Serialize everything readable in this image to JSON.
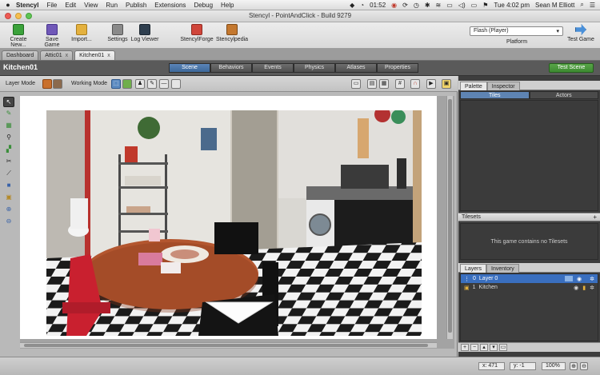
{
  "menubar": {
    "apple": "",
    "app": "Stencyl",
    "items": [
      "File",
      "Edit",
      "View",
      "Run",
      "Publish",
      "Extensions",
      "Debug",
      "Help"
    ],
    "clock_count": "01:52",
    "time": "Tue 4:02 pm",
    "user": "Sean M Elliott"
  },
  "window": {
    "title": "Stencyl - PointAndClick - Build 9279"
  },
  "toolbar": {
    "create_new": "Create New...",
    "save_game": "Save Game",
    "import": "Import...",
    "settings": "Settings",
    "log_viewer": "Log Viewer",
    "stencylforge": "StencylForge",
    "stencylpedia": "Stencylpedia",
    "target": "Flash (Player)",
    "platform_label": "Platform",
    "test_game": "Test Game"
  },
  "doc_tabs": [
    {
      "label": "Dashboard"
    },
    {
      "label": "Attic01",
      "close": "x"
    },
    {
      "label": "Kitchen01",
      "close": "x"
    }
  ],
  "scene": {
    "name": "Kitchen01",
    "tabs": [
      "Scene",
      "Behaviors",
      "Events",
      "Physics",
      "Atlases",
      "Properties"
    ],
    "test_scene": "Test Scene"
  },
  "modebar": {
    "layer_mode": "Layer Mode",
    "working_mode": "Working Mode"
  },
  "palette": {
    "tabs": [
      "Palette",
      "Inspector"
    ],
    "subtabs": [
      "Tiles",
      "Actors"
    ]
  },
  "tilesets": {
    "title": "Tilesets",
    "plus": "+",
    "empty_message": "This game contains no Tilesets"
  },
  "layers": {
    "tabs": [
      "Layers",
      "Inventory"
    ],
    "rows": [
      {
        "index": "0",
        "name": "Layer 0"
      },
      {
        "index": "1",
        "name": "Kitchen"
      }
    ]
  },
  "status": {
    "x": "x: 471",
    "y": "y: -1",
    "zoom": "100%"
  },
  "colors": {
    "accent": "#3d6899",
    "test_green": "#3d8a31",
    "selection": "#3a6fbf"
  }
}
